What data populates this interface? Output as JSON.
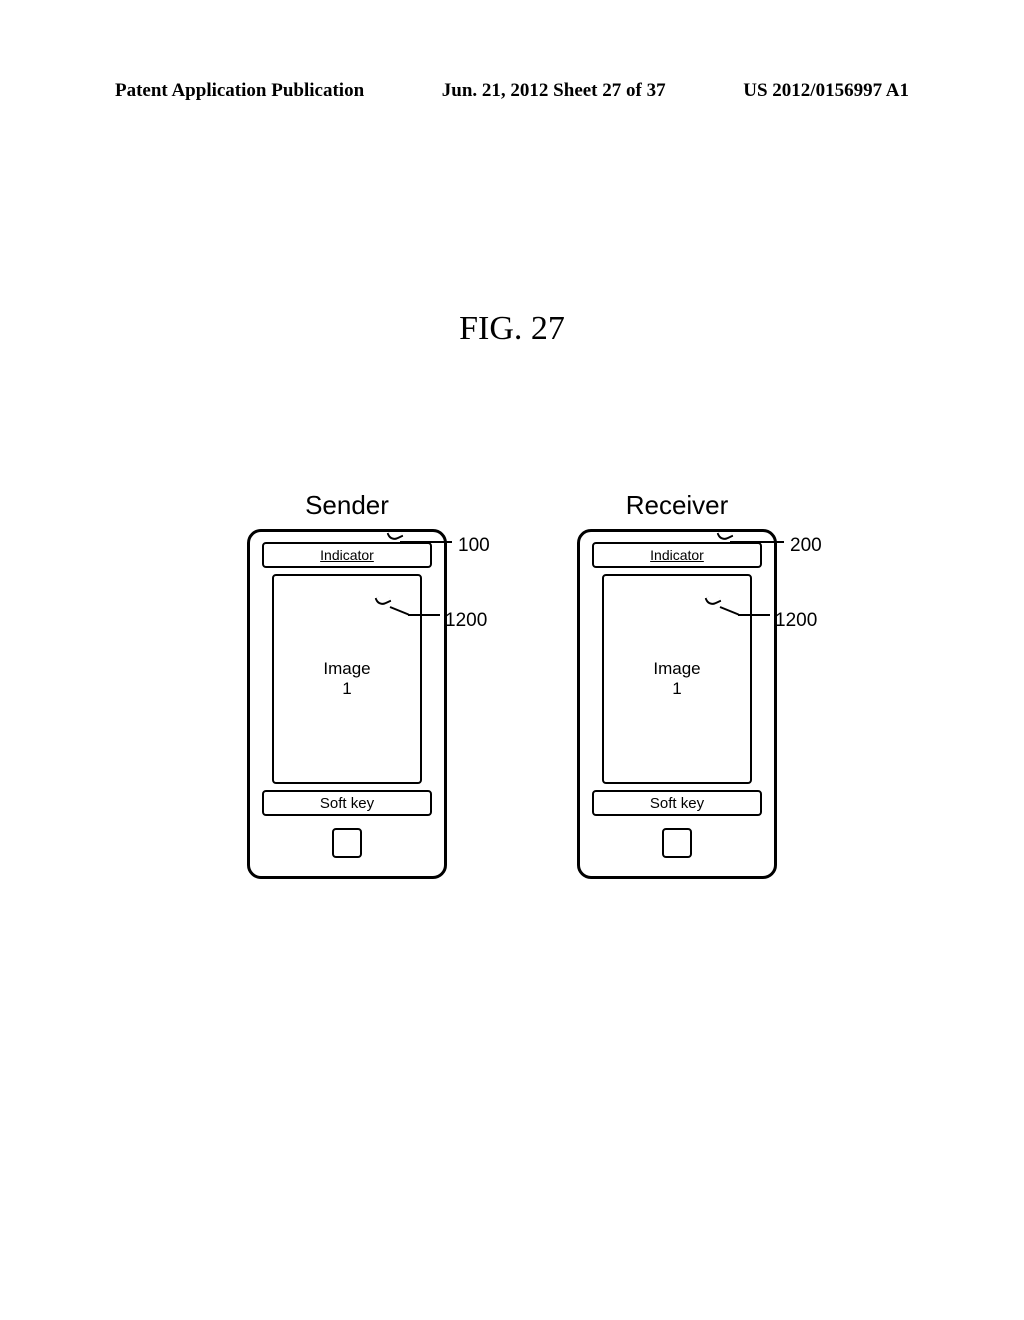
{
  "header": {
    "left": "Patent Application Publication",
    "center": "Jun. 21, 2012  Sheet 27 of 37",
    "right": "US 2012/0156997 A1"
  },
  "figure_title": "FIG. 27",
  "devices": {
    "sender": {
      "label": "Sender",
      "indicator": "Indicator",
      "image_text_line1": "Image",
      "image_text_line2": "1",
      "softkey": "Soft key"
    },
    "receiver": {
      "label": "Receiver",
      "indicator": "Indicator",
      "image_text_line1": "Image",
      "image_text_line2": "1",
      "softkey": "Soft key"
    }
  },
  "references": {
    "sender_device": "100",
    "sender_image": "1200",
    "receiver_device": "200",
    "receiver_image": "1200"
  }
}
